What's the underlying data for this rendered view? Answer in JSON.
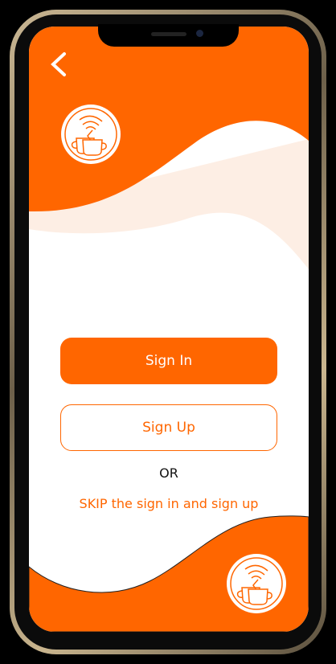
{
  "colors": {
    "accent": "#ff6600",
    "cream": "#fdeee4"
  },
  "header": {
    "back_icon": "chevron-left-icon"
  },
  "logo": {
    "icon": "wifi-coffee-cup-icon"
  },
  "actions": {
    "sign_in": "Sign In",
    "sign_up": "Sign Up",
    "or": "OR",
    "skip": "SKIP the sign in and sign up"
  }
}
